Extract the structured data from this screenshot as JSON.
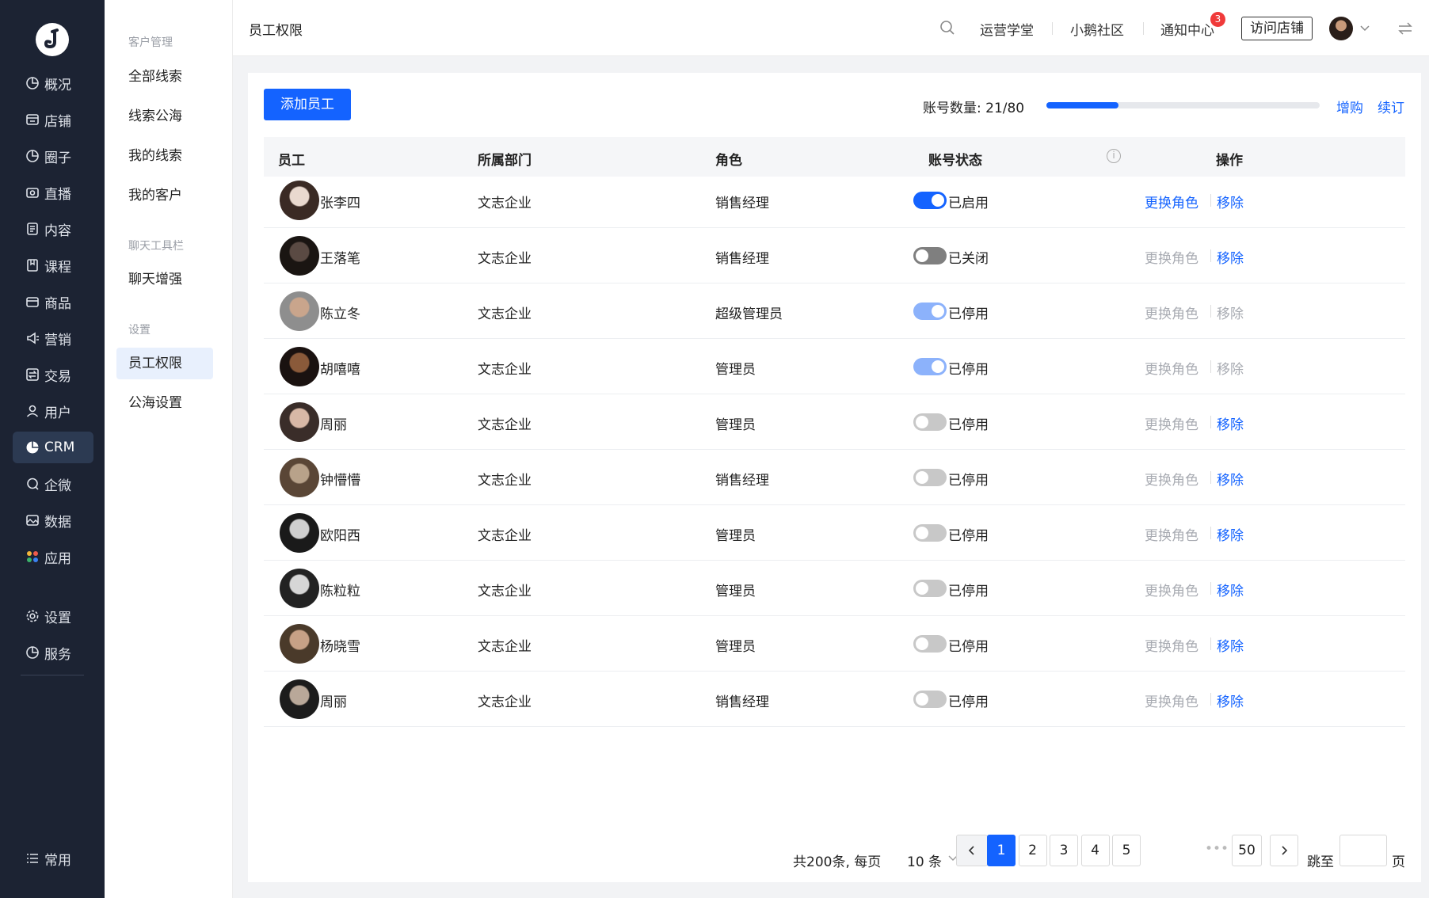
{
  "nav": {
    "items": [
      {
        "label": "概况",
        "icon": "pie-chart-icon"
      },
      {
        "label": "店铺",
        "icon": "store-icon"
      },
      {
        "label": "圈子",
        "icon": "pie-chart-icon"
      },
      {
        "label": "直播",
        "icon": "camera-icon"
      },
      {
        "label": "内容",
        "icon": "document-icon"
      },
      {
        "label": "课程",
        "icon": "book-icon"
      },
      {
        "label": "商品",
        "icon": "box-icon"
      },
      {
        "label": "营销",
        "icon": "megaphone-icon"
      },
      {
        "label": "交易",
        "icon": "exchange-icon"
      },
      {
        "label": "用户",
        "icon": "user-icon"
      },
      {
        "label": "CRM",
        "icon": "pie-chart-icon"
      },
      {
        "label": "企微",
        "icon": "chat-icon"
      },
      {
        "label": "数据",
        "icon": "image-icon"
      },
      {
        "label": "应用",
        "icon": "apps-icon"
      }
    ],
    "bottom_items": [
      {
        "label": "设置",
        "icon": "gear-icon"
      },
      {
        "label": "服务",
        "icon": "pie-chart-icon"
      }
    ],
    "common_label": "常用"
  },
  "subnav": {
    "groups": [
      {
        "title": "客户管理",
        "items": [
          "全部线索",
          "线索公海",
          "我的线索",
          "我的客户"
        ]
      },
      {
        "title": "聊天工具栏",
        "items": [
          "聊天增强"
        ]
      },
      {
        "title": "设置",
        "items": [
          "员工权限",
          "公海设置"
        ]
      }
    ]
  },
  "header": {
    "title": "员工权限",
    "links": [
      "运营学堂",
      "小鹅社区",
      "通知中心"
    ],
    "notify_count": "3",
    "visit_button": "访问店铺"
  },
  "toolbar": {
    "add_button": "添加员工",
    "account_count_label": "账号数量: 21/80",
    "account_used": 21,
    "account_total": 80,
    "buy_more": "增购",
    "renew": "续订"
  },
  "table": {
    "headers": [
      "员工",
      "所属部门",
      "角色",
      "账号状态",
      "操作"
    ],
    "action_change": "更换角色",
    "action_remove": "移除",
    "rows": [
      {
        "name": "张李四",
        "dept": "文志企业",
        "role": "销售经理",
        "status": "已启用",
        "toggle": "on",
        "change_enabled": true,
        "remove_enabled": true,
        "avatar_colors": [
          "#e9d9cf",
          "#3a2a24"
        ]
      },
      {
        "name": "王落笔",
        "dept": "文志企业",
        "role": "销售经理",
        "status": "已关闭",
        "toggle": "grey",
        "change_enabled": false,
        "remove_enabled": true,
        "avatar_colors": [
          "#5a4a43",
          "#1a1512"
        ]
      },
      {
        "name": "陈立冬",
        "dept": "文志企业",
        "role": "超级管理员",
        "status": "已停用",
        "toggle": "dis",
        "change_enabled": false,
        "remove_enabled": false,
        "avatar_colors": [
          "#c9a58c",
          "#8e8e8e"
        ]
      },
      {
        "name": "胡嘻嘻",
        "dept": "文志企业",
        "role": "管理员",
        "status": "已停用",
        "toggle": "dis",
        "change_enabled": false,
        "remove_enabled": false,
        "avatar_colors": [
          "#8a5a3a",
          "#1a1210"
        ]
      },
      {
        "name": "周丽",
        "dept": "文志企业",
        "role": "管理员",
        "status": "已停用",
        "toggle": "off",
        "change_enabled": false,
        "remove_enabled": true,
        "avatar_colors": [
          "#d8b8a6",
          "#3a2d29"
        ]
      },
      {
        "name": "钟懵懵",
        "dept": "文志企业",
        "role": "销售经理",
        "status": "已停用",
        "toggle": "off",
        "change_enabled": false,
        "remove_enabled": true,
        "avatar_colors": [
          "#b8a28a",
          "#5a4636"
        ]
      },
      {
        "name": "欧阳西",
        "dept": "文志企业",
        "role": "管理员",
        "status": "已停用",
        "toggle": "off",
        "change_enabled": false,
        "remove_enabled": true,
        "avatar_colors": [
          "#cfcfcf",
          "#1a1a1a"
        ]
      },
      {
        "name": "陈粒粒",
        "dept": "文志企业",
        "role": "管理员",
        "status": "已停用",
        "toggle": "off",
        "change_enabled": false,
        "remove_enabled": true,
        "avatar_colors": [
          "#d6d6d6",
          "#222222"
        ]
      },
      {
        "name": "杨晓雪",
        "dept": "文志企业",
        "role": "管理员",
        "status": "已停用",
        "toggle": "off",
        "change_enabled": false,
        "remove_enabled": true,
        "avatar_colors": [
          "#c7a186",
          "#4a3a2a"
        ]
      },
      {
        "name": "周丽",
        "dept": "文志企业",
        "role": "销售经理",
        "status": "已停用",
        "toggle": "off",
        "change_enabled": false,
        "remove_enabled": true,
        "avatar_colors": [
          "#b9a899",
          "#1c1c1c"
        ]
      }
    ]
  },
  "pagination": {
    "total_text": "共200条, 每页",
    "page_size": "10 条",
    "pages": [
      "1",
      "2",
      "3",
      "4",
      "5"
    ],
    "current": "1",
    "last": "50",
    "jump_label": "跳至",
    "page_suffix": "页"
  }
}
